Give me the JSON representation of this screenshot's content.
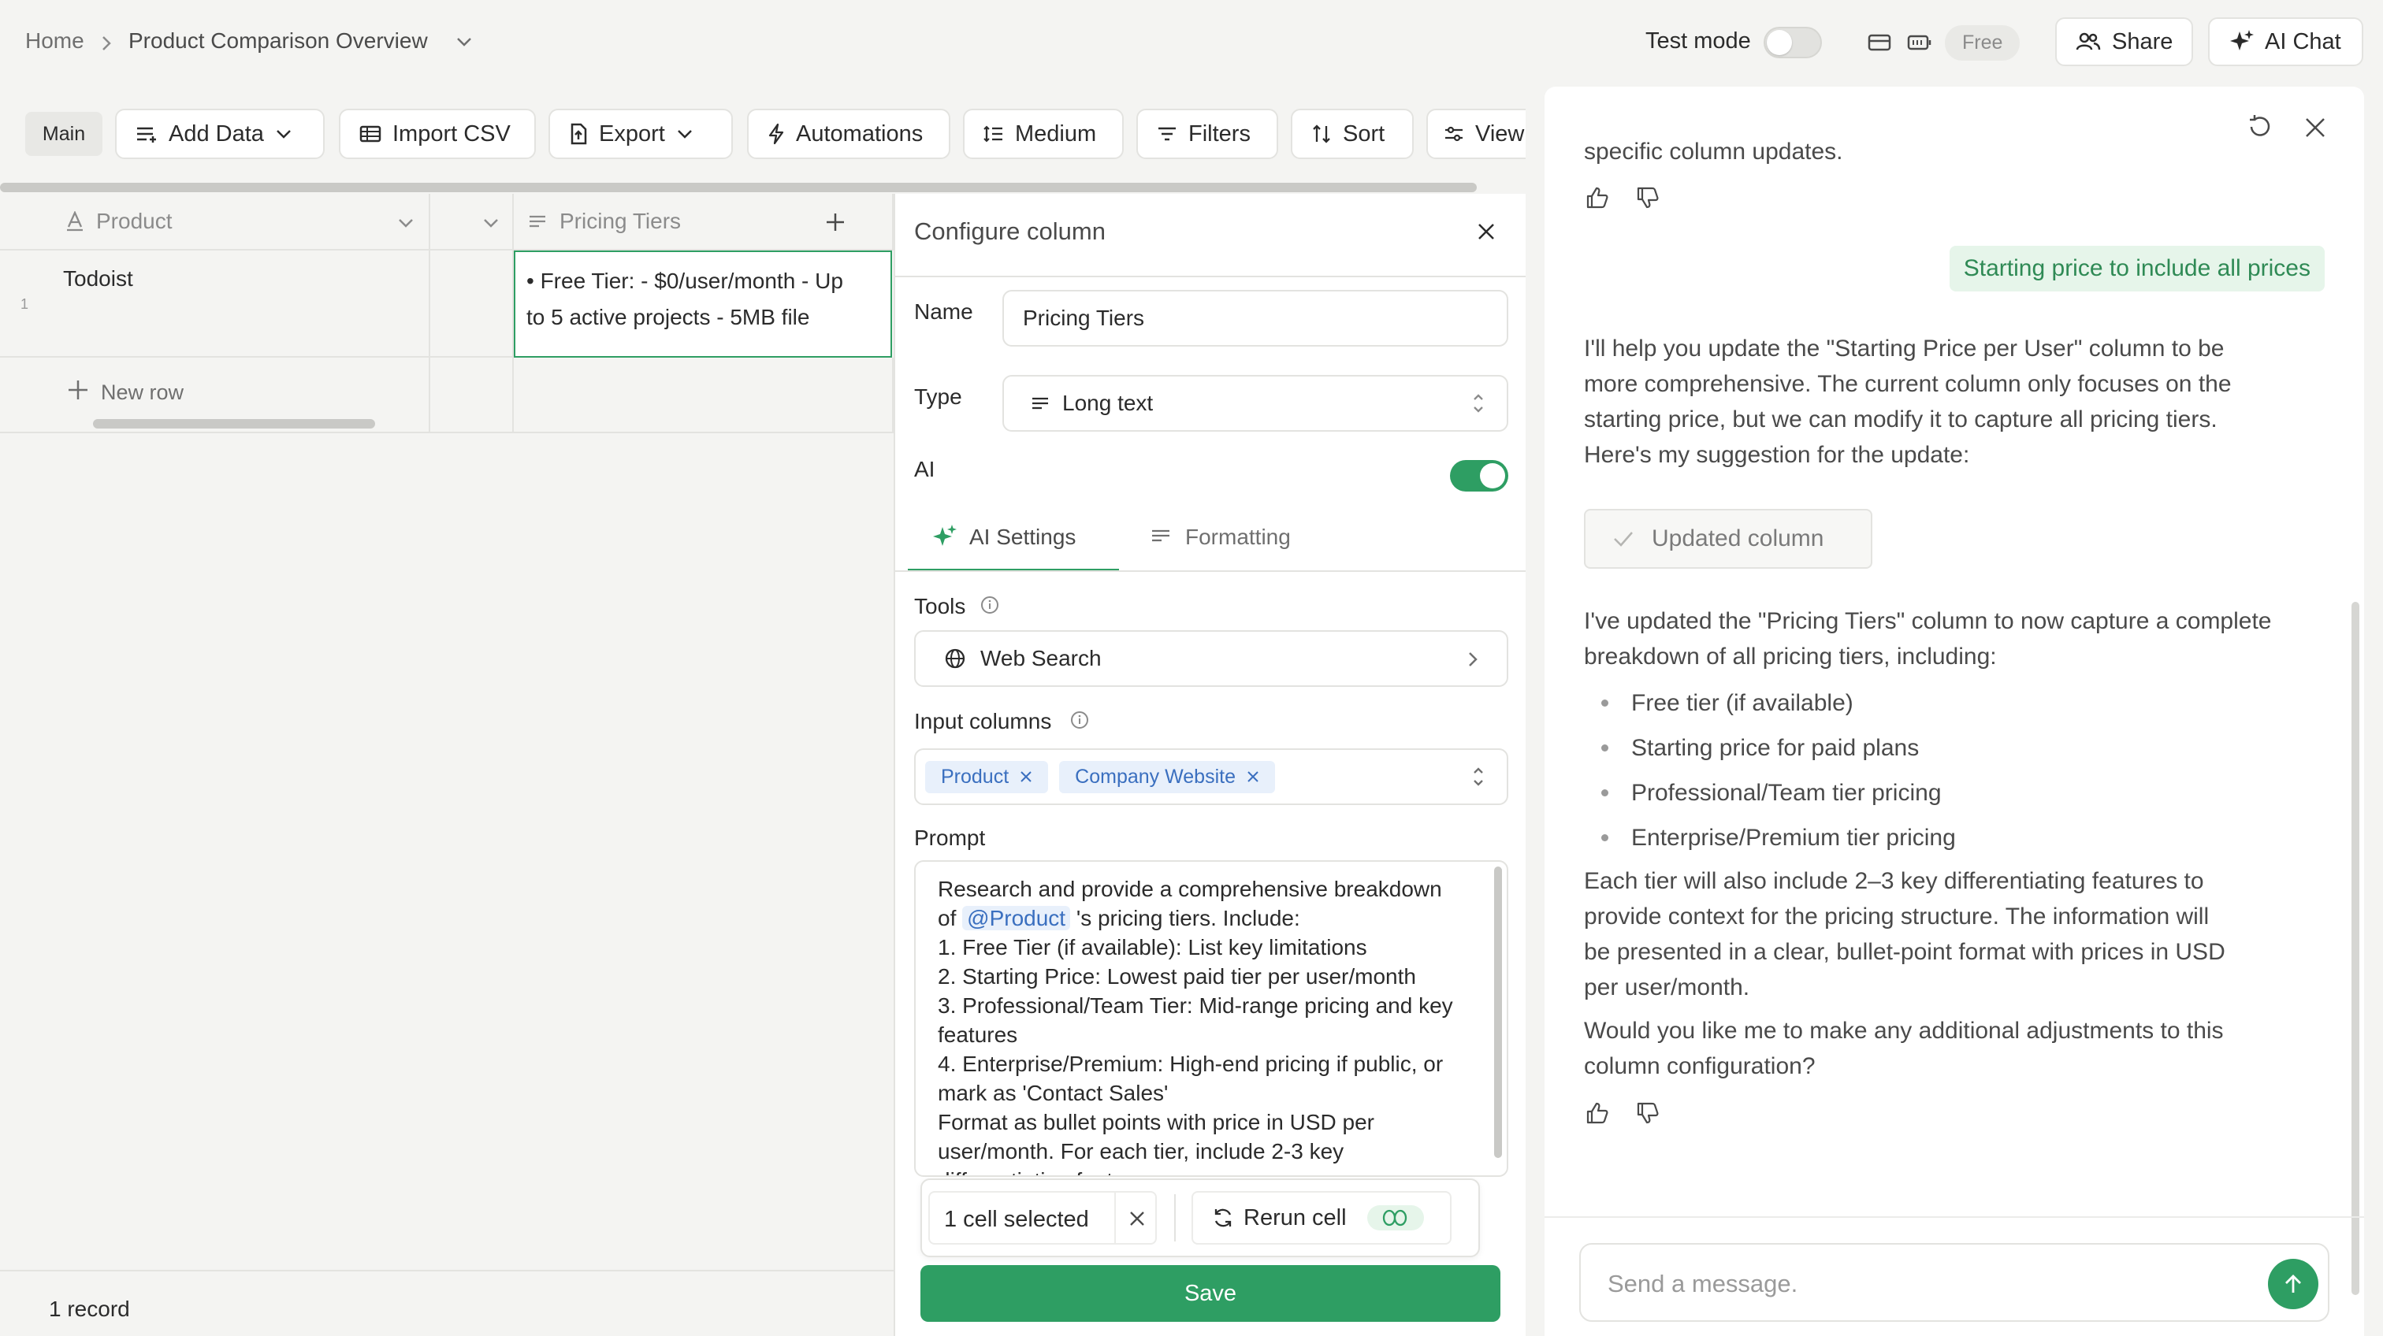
{
  "breadcrumb": {
    "home": "Home",
    "current": "Product Comparison Overview"
  },
  "topbar": {
    "test_mode_label": "Test mode",
    "plan_badge": "Free",
    "share_label": "Share",
    "ai_chat_label": "AI Chat"
  },
  "toolbar": {
    "main_tab": "Main",
    "add_data": "Add Data",
    "import_csv": "Import CSV",
    "export": "Export",
    "automations": "Automations",
    "row_height": "Medium",
    "filters": "Filters",
    "sort": "Sort",
    "view": "View"
  },
  "grid": {
    "columns": [
      {
        "label": "Product",
        "type_icon": "text-a-icon"
      },
      {
        "label": "",
        "type_icon": ""
      },
      {
        "label": "Pricing Tiers",
        "type_icon": "long-text-icon"
      }
    ],
    "rows": [
      {
        "number": "1",
        "product": "Todoist",
        "pricing_line1": "• Free Tier:  - $0/user/month  - Up",
        "pricing_line2": "to 5 active projects  - 5MB file"
      }
    ],
    "new_row_label": "New row",
    "record_count": "1 record"
  },
  "config": {
    "title": "Configure column",
    "name_label": "Name",
    "name_value": "Pricing Tiers",
    "type_label": "Type",
    "type_value": "Long text",
    "ai_label": "AI",
    "ai_enabled": true,
    "tabs": [
      "AI Settings",
      "Formatting"
    ],
    "tools_label": "Tools",
    "tool_value": "Web Search",
    "input_columns_label": "Input columns",
    "input_columns": [
      "Product",
      "Company Website"
    ],
    "prompt_label": "Prompt",
    "prompt": {
      "l1": "Research and provide a comprehensive breakdown",
      "l2_pre": "of",
      "mention": "@Product",
      "l2_post": "'s pricing tiers. Include:",
      "l3": "1. Free Tier (if available): List key limitations",
      "l4": "2. Starting Price: Lowest paid tier per user/month",
      "l5": "3. Professional/Team Tier: Mid-range pricing and key",
      "l6": "features",
      "l7": "4. Enterprise/Premium: High-end pricing if public, or",
      "l8": "mark as 'Contact Sales'",
      "l9": "Format as bullet points with price in USD per",
      "l10": "user/month. For each tier, include 2-3 key",
      "l11": "differentiating features"
    },
    "selection_label": "1 cell selected",
    "rerun_label": "Rerun cell",
    "save_label": "Save"
  },
  "chat": {
    "partial_top": "specific column updates.",
    "user_message": "Starting price to include all prices",
    "reply1": [
      "I'll help you update the \"Starting Price per User\" column to be",
      "more comprehensive. The current column only focuses on the",
      "starting price, but we can modify it to capture all pricing tiers.",
      "Here's my suggestion for the update:"
    ],
    "updated_badge": "Updated column",
    "reply2_intro": [
      "I've updated the \"Pricing Tiers\" column to now capture a complete",
      "breakdown of all pricing tiers, including:"
    ],
    "bullets": [
      "Free tier (if available)",
      "Starting price for paid plans",
      "Professional/Team tier pricing",
      "Enterprise/Premium tier pricing"
    ],
    "reply2_body": [
      "Each tier will also include 2–3 key differentiating features to",
      "provide context for the pricing structure. The information will",
      "be presented in a clear, bullet-point format with prices in USD",
      "per user/month."
    ],
    "reply2_question": [
      "Would you like me to make any additional adjustments to this",
      "column configuration?"
    ],
    "input_placeholder": "Send a message."
  },
  "colors": {
    "accent_green": "#2e9e63",
    "chip_blue": "#3a6fbf",
    "user_bubble_bg": "#e6f5ea"
  }
}
